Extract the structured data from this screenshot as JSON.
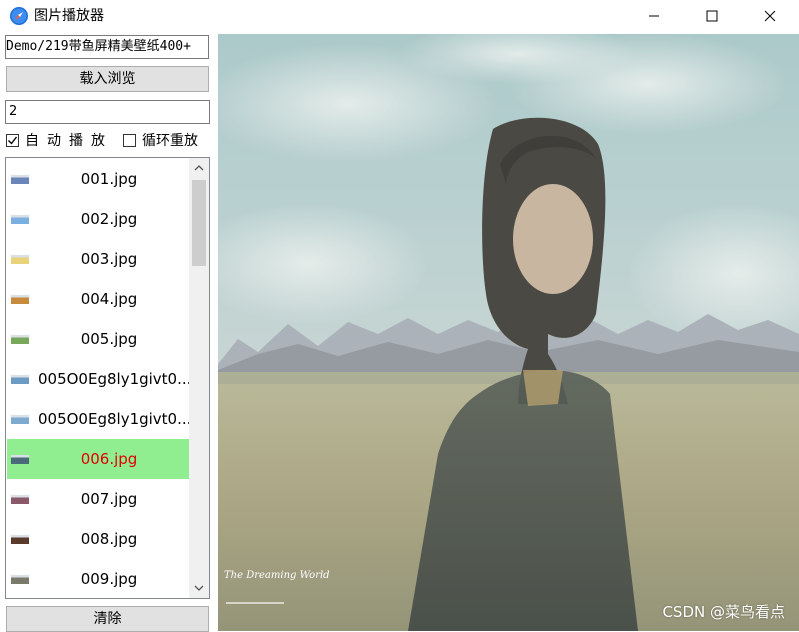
{
  "window": {
    "title": "图片播放器",
    "icon": "compass-icon"
  },
  "controls": {
    "path_value": "Demo/219带鱼屏精美壁纸400+",
    "load_label": "载入浏览",
    "interval_value": "2",
    "autoplay": {
      "label": "自动播放",
      "checked": true
    },
    "loop": {
      "label": "循环重放",
      "checked": false
    },
    "clear_label": "清除"
  },
  "file_list": {
    "selected": "006.jpg",
    "items": [
      {
        "label": "001.jpg",
        "thumb": "#6a86b8"
      },
      {
        "label": "002.jpg",
        "thumb": "#7ab0e0"
      },
      {
        "label": "003.jpg",
        "thumb": "#e8d27a"
      },
      {
        "label": "004.jpg",
        "thumb": "#c88a3c"
      },
      {
        "label": "005.jpg",
        "thumb": "#78a85a"
      },
      {
        "label": "005O0Eg8ly1givt0...",
        "thumb": "#6c9cc4"
      },
      {
        "label": "005O0Eg8ly1givt0...",
        "thumb": "#7eaad0"
      },
      {
        "label": "006.jpg",
        "thumb": "#4a6a7a"
      },
      {
        "label": "007.jpg",
        "thumb": "#8a5a6a"
      },
      {
        "label": "008.jpg",
        "thumb": "#5a3a2a"
      },
      {
        "label": "009.jpg",
        "thumb": "#7a7a6a"
      }
    ]
  },
  "preview": {
    "watermark": "CSDN @菜鸟看点",
    "colors": {
      "sky": "#9cc0c6",
      "field": "#a6a27a",
      "mountains": "#a8acb4"
    }
  }
}
